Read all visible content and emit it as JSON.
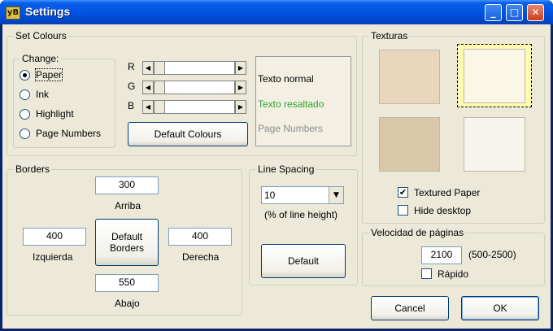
{
  "window": {
    "title": "Settings",
    "app_icon": "yB",
    "close_glyph": "✕",
    "min_glyph": "_",
    "max_glyph": "□"
  },
  "colours": {
    "group_label": "Set Colours",
    "change_label": "Change:",
    "options": [
      "Paper",
      "Ink",
      "Highlight",
      "Page Numbers"
    ],
    "selected": "Paper",
    "r_label": "R",
    "g_label": "G",
    "b_label": "B",
    "default_button": "Default Colours",
    "preview": {
      "normal": "Texto normal",
      "highlight": "Texto resaltado",
      "page_numbers": "Page Numbers"
    },
    "highlight_color": "#2fa52f",
    "page_numbers_color": "#8c8c8c"
  },
  "texturas": {
    "group_label": "Texturas",
    "swatch_colors": [
      "#e8d6bd",
      "#fbf7e6",
      "#d9c7a8",
      "#f7f4ee"
    ],
    "selected_index": 1,
    "textured_paper": {
      "label": "Textured Paper",
      "checked": true
    },
    "hide_desktop": {
      "label": "Hide desktop",
      "checked": false
    }
  },
  "borders": {
    "group_label": "Borders",
    "arriba": {
      "value": "300",
      "label": "Arriba"
    },
    "izquierda": {
      "value": "400",
      "label": "Izquierda"
    },
    "derecha": {
      "value": "400",
      "label": "Derecha"
    },
    "abajo": {
      "value": "550",
      "label": "Abajo"
    },
    "default_button_line1": "Default",
    "default_button_line2": "Borders"
  },
  "line_spacing": {
    "group_label": "Line Spacing",
    "value": "10",
    "hint": "(% of line height)",
    "default_button": "Default"
  },
  "velocidad": {
    "group_label": "Velocidad de páginas",
    "value": "2100",
    "range": "(500-2500)",
    "rapido": {
      "label": "Rápido",
      "checked": false
    }
  },
  "buttons": {
    "cancel": "Cancel",
    "ok": "OK"
  }
}
